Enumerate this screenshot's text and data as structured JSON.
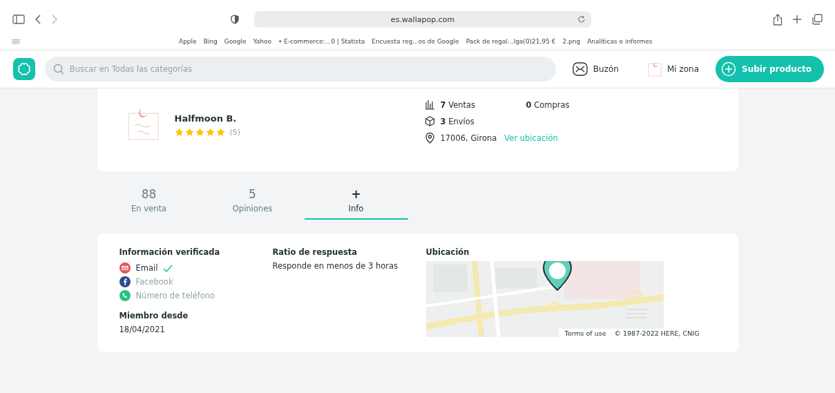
{
  "browser": {
    "address": "es.wallapop.com",
    "bookmarks": [
      "Apple",
      "Bing",
      "Google",
      "Yahoo",
      "• E-commerce:...0 | Statista",
      "Encuesta reg...os de Google",
      "Pack de regal...lga(0)21,95 €",
      "2.png",
      "Analíticas e informes"
    ]
  },
  "header": {
    "search": {
      "placeholder": "Buscar en Todas las categorías"
    },
    "inbox": "Buzón",
    "zone": "Mi zona",
    "upload": "Subir producto"
  },
  "profile": {
    "name": "Halfmoon B.",
    "stars": 5,
    "reviews": "(5)",
    "sales_count": "7",
    "sales": "Ventas",
    "purchases_count": "0",
    "purchases": "Compras",
    "shipments_count": "3",
    "shipments": "Envíos",
    "location": "17006, Girona",
    "location_link": "Ver ubicación"
  },
  "tabs": [
    {
      "value": "88",
      "label": "En venta",
      "selected": false
    },
    {
      "value": "5",
      "label": "Opiniones",
      "selected": false
    },
    {
      "value": "+",
      "label": "Info",
      "selected": true
    }
  ],
  "info": {
    "verified_title": "Información verificada",
    "verifications": [
      {
        "kind": "email",
        "label": "Email",
        "verified": true
      },
      {
        "kind": "facebook",
        "label": "Facebook",
        "verified": false
      },
      {
        "kind": "phone",
        "label": "Número de teléfono",
        "verified": false
      }
    ],
    "member_title": "Miembro desde",
    "member_date": "18/04/2021",
    "response_title": "Ratio de respuesta",
    "response_text": "Responde en menos de 3 horas",
    "location_title": "Ubicación",
    "map_terms": "Terms of use",
    "map_copyright": "© 1987-2022 HERE, CNIG"
  }
}
